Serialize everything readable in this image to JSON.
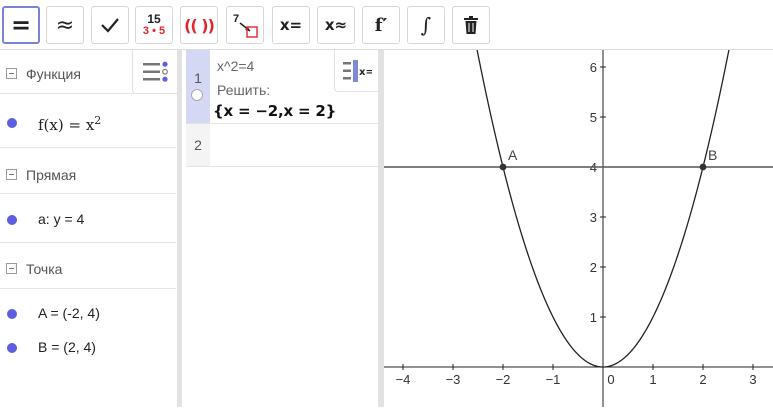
{
  "toolbar": {
    "buttons": [
      {
        "name": "equals",
        "label": "="
      },
      {
        "name": "approx",
        "label": "≈"
      },
      {
        "name": "check",
        "label": "✓"
      },
      {
        "name": "factor",
        "top": "15",
        "bottom": "3 • 5"
      },
      {
        "name": "expand",
        "label": "(( ))"
      },
      {
        "name": "substitute",
        "label": "7"
      },
      {
        "name": "solve",
        "label": "x="
      },
      {
        "name": "nsolve",
        "label": "x≈"
      },
      {
        "name": "derivative",
        "label": "f′"
      },
      {
        "name": "integral",
        "label": "∫"
      },
      {
        "name": "delete",
        "label": ""
      }
    ]
  },
  "algebra": {
    "categories": [
      {
        "label": "Функция",
        "items": [
          {
            "text_main": "f(x)  =  x",
            "text_sup": "2"
          }
        ]
      },
      {
        "label": "Прямая",
        "items": [
          {
            "text": "a: y = 4"
          }
        ]
      },
      {
        "label": "Точка",
        "items": [
          {
            "text": "A = (-2, 4)"
          },
          {
            "text": "B = (2, 4)"
          }
        ]
      }
    ]
  },
  "cas": {
    "rows": [
      {
        "number": "1",
        "input": "x^2=4",
        "command": "Решить:",
        "result": "{x = −2,x = 2}"
      },
      {
        "number": "2",
        "input": "",
        "command": "",
        "result": ""
      }
    ]
  },
  "graphics": {
    "x_ticks": [
      "−4",
      "−3",
      "−2",
      "−1",
      "0",
      "1",
      "2",
      "3"
    ],
    "y_ticks": [
      "1",
      "2",
      "3",
      "4",
      "5",
      "6"
    ],
    "origin_label": "0",
    "points": [
      {
        "label": "A",
        "x": -2,
        "y": 4
      },
      {
        "label": "B",
        "x": 2,
        "y": 4
      }
    ],
    "function_expr": "x^2",
    "line_y": 4,
    "colors": {
      "curve": "#222222",
      "line": "#555555",
      "point": "#333333",
      "accent": "#5c5fe0"
    }
  }
}
